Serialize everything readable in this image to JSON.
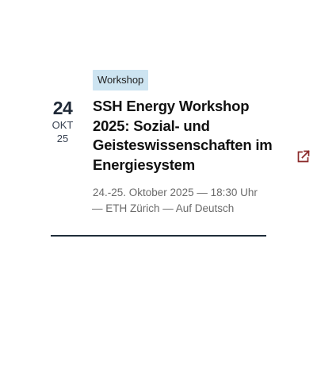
{
  "event": {
    "category": "Workshop",
    "date": {
      "day": "24",
      "month": "OKT",
      "year": "25"
    },
    "title": "SSH Energy Workshop 2025: Sozial- und Geisteswissenschaften im Energiesystem",
    "meta_line1": "24.-25. Oktober 2025 — 18:30 Uhr",
    "meta_line2": "— ETH Zürich — Auf Deutsch",
    "external_link_icon": "external-link-icon",
    "colors": {
      "badge_bg": "#cde4f1",
      "icon": "#8b2a2a",
      "divider": "#1f2d3a"
    }
  }
}
